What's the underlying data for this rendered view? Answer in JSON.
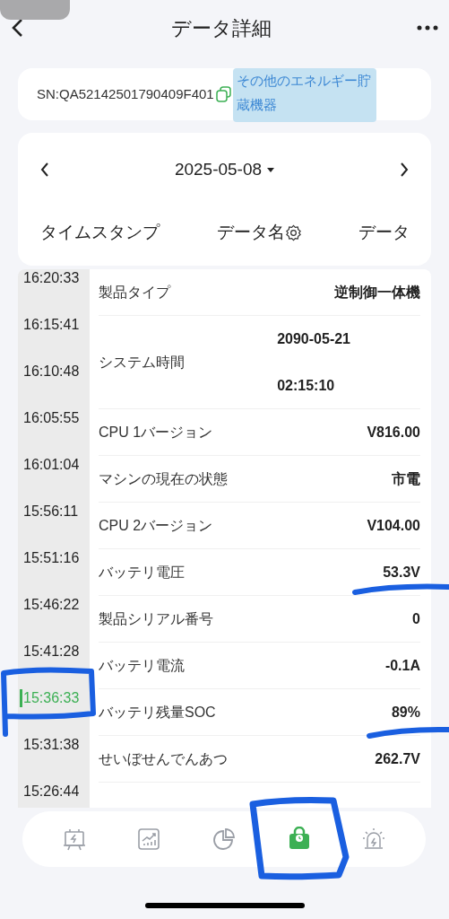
{
  "header": {
    "title": "データ詳細"
  },
  "device": {
    "serial": "SN:QA52142501790409F401",
    "category": "その他のエネルギー貯蔵機器"
  },
  "date_picker": {
    "date": "2025-05-08"
  },
  "columns": [
    "タイムスタンプ",
    "データ名",
    "データ"
  ],
  "timestamps": [
    {
      "time": "16:20:33",
      "selected": false
    },
    {
      "time": "16:15:41",
      "selected": false
    },
    {
      "time": "16:10:48",
      "selected": false
    },
    {
      "time": "16:05:55",
      "selected": false
    },
    {
      "time": "16:01:04",
      "selected": false
    },
    {
      "time": "15:56:11",
      "selected": false
    },
    {
      "time": "15:51:16",
      "selected": false
    },
    {
      "time": "15:46:22",
      "selected": false
    },
    {
      "time": "15:41:28",
      "selected": false
    },
    {
      "time": "15:36:33",
      "selected": true
    },
    {
      "time": "15:31:38",
      "selected": false
    },
    {
      "time": "15:26:44",
      "selected": false
    }
  ],
  "rows": [
    {
      "name": "製品タイプ",
      "values": [
        "逆制御一体機"
      ]
    },
    {
      "name": "システム時間",
      "values": [
        "2090-05-21",
        "02:15:10"
      ]
    },
    {
      "name": "CPU 1バージョン",
      "values": [
        "V816.00"
      ]
    },
    {
      "name": "マシンの現在の状態",
      "values": [
        "市電"
      ]
    },
    {
      "name": "CPU 2バージョン",
      "values": [
        "V104.00"
      ]
    },
    {
      "name": "バッテリ電圧",
      "values": [
        "53.3V"
      ]
    },
    {
      "name": "製品シリアル番号",
      "values": [
        "0"
      ]
    },
    {
      "name": "バッテリ電流",
      "values": [
        "-0.1A"
      ]
    },
    {
      "name": "バッテリ残量SOC",
      "values": [
        "89%"
      ]
    },
    {
      "name": "せいぼせんでんあつ",
      "values": [
        "262.7V"
      ]
    }
  ],
  "nav": [
    {
      "kind": "monitor",
      "selected": false
    },
    {
      "kind": "chart",
      "selected": false
    },
    {
      "kind": "pie",
      "selected": false
    },
    {
      "kind": "bag",
      "selected": true
    },
    {
      "kind": "alarm",
      "selected": false
    }
  ]
}
